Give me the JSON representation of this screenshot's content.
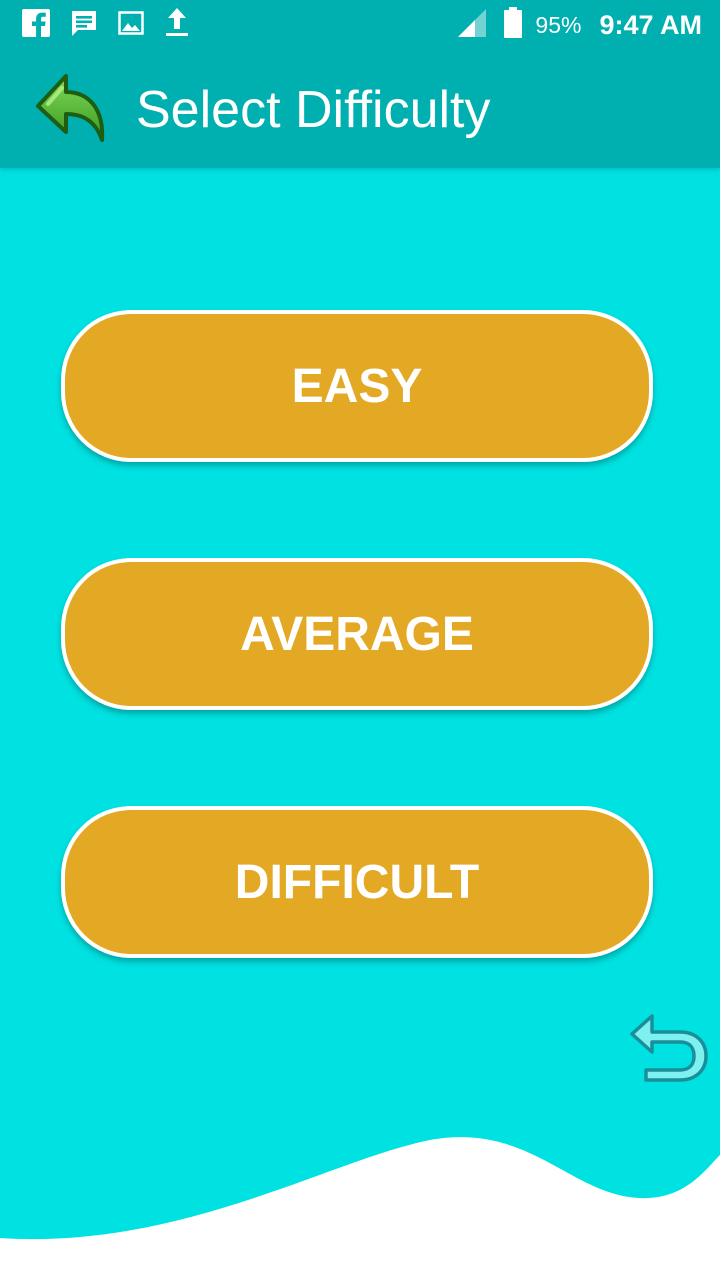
{
  "status_bar": {
    "battery_percent": "95%",
    "time": "9:47 AM",
    "icons": [
      "facebook-icon",
      "message-icon",
      "image-icon",
      "upload-icon",
      "signal-icon",
      "battery-icon"
    ]
  },
  "app_bar": {
    "title": "Select Difficulty",
    "back_icon": "back-arrow-icon"
  },
  "difficulties": {
    "easy": "EASY",
    "average": "AVERAGE",
    "difficult": "DIFFICULT"
  },
  "undo_icon": "undo-icon",
  "colors": {
    "status_bar": "#00AFAF",
    "app_bar": "#00AFAF",
    "background": "#00E1E1",
    "button": "#E3A924",
    "button_border": "#FFFFFF",
    "back_arrow": "#4CAF2F",
    "wave": "#FFFFFF"
  }
}
